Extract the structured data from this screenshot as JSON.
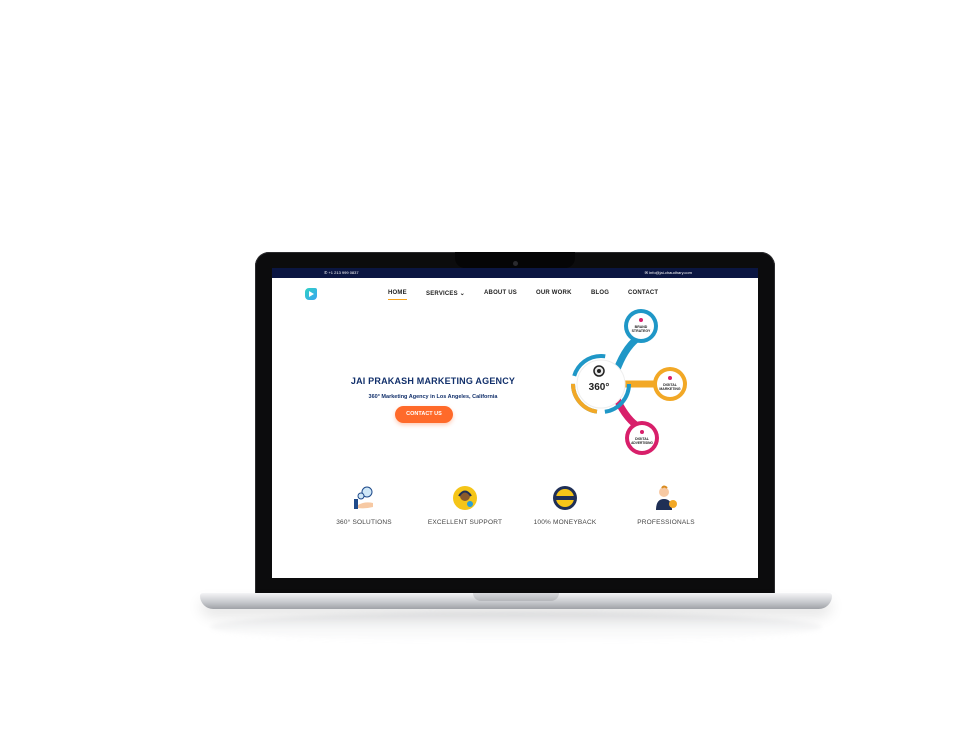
{
  "topbar": {
    "phone": "+1 213 999 0837",
    "email": "info@jai-chaudhary.com"
  },
  "nav": {
    "items": [
      {
        "label": "HOME",
        "active": true
      },
      {
        "label": "SERVICES ⌄",
        "active": false
      },
      {
        "label": "ABOUT US",
        "active": false
      },
      {
        "label": "OUR WORK",
        "active": false
      },
      {
        "label": "BLOG",
        "active": false
      },
      {
        "label": "CONTACT",
        "active": false
      }
    ]
  },
  "hero": {
    "title": "JAI PRAKASH MARKETING AGENCY",
    "subtitle": "360° Marketing Agency in Los Angeles, California",
    "cta_label": "CONTACT US"
  },
  "diagram": {
    "center_label": "360°",
    "nodes": [
      {
        "label_line1": "BRAND",
        "label_line2": "STRATEGY",
        "color": "#1f97c7"
      },
      {
        "label_line1": "DIGITAL",
        "label_line2": "MARKETING",
        "color": "#f2a826"
      },
      {
        "label_line1": "DIGITAL",
        "label_line2": "ADVERTISING",
        "color": "#d81f6a"
      }
    ]
  },
  "features": [
    {
      "label": "360° SOLUTIONS",
      "icon": "hand-ideas-icon"
    },
    {
      "label": "EXCELLENT SUPPORT",
      "icon": "support-headset-icon"
    },
    {
      "label": "100% MONEYBACK",
      "icon": "moneyback-badge-icon"
    },
    {
      "label": "PROFESSIONALS",
      "icon": "professional-person-icon"
    }
  ],
  "colors": {
    "topbar": "#0b1642",
    "heading": "#12306b",
    "cta": "#ff6a2a",
    "nav_active_underline": "#f7a21b"
  }
}
